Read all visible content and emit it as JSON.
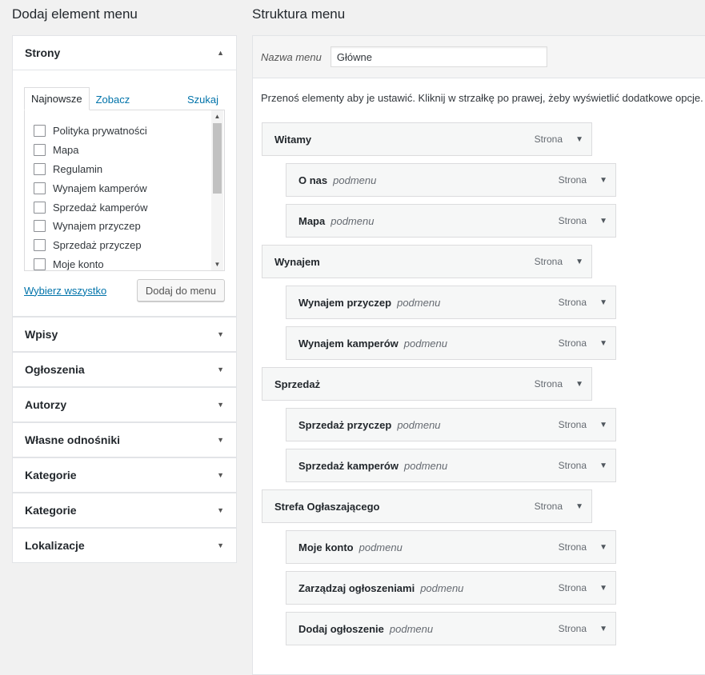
{
  "left": {
    "title": "Dodaj element menu",
    "strony": {
      "heading": "Strony",
      "tabs": [
        "Najnowsze",
        "Zobacz wszystkie",
        "Szukaj"
      ],
      "pages": [
        "Polityka prywatności",
        "Mapa",
        "Regulamin",
        "Wynajem kamperów",
        "Sprzedaż kamperów",
        "Wynajem przyczep",
        "Sprzedaż przyczep",
        "Moje konto"
      ],
      "select_all": "Wybierz wszystko",
      "add_button": "Dodaj do menu"
    },
    "sections": [
      "Wpisy",
      "Ogłoszenia",
      "Autorzy",
      "Własne odnośniki",
      "Kategorie",
      "Kategorie",
      "Lokalizacje"
    ]
  },
  "right": {
    "title": "Struktura menu",
    "menu_name_label": "Nazwa menu",
    "menu_name_value": "Główne",
    "instructions": "Przenoś elementy aby je ustawić. Kliknij w strzałkę po prawej, żeby wyświetlić dodatkowe opcje.",
    "items": [
      {
        "title": "Witamy",
        "sub": "",
        "type": "Strona",
        "depth": 0
      },
      {
        "title": "O nas",
        "sub": "podmenu",
        "type": "Strona",
        "depth": 1
      },
      {
        "title": "Mapa",
        "sub": "podmenu",
        "type": "Strona",
        "depth": 1
      },
      {
        "title": "Wynajem",
        "sub": "",
        "type": "Strona",
        "depth": 0
      },
      {
        "title": "Wynajem przyczep",
        "sub": "podmenu",
        "type": "Strona",
        "depth": 1
      },
      {
        "title": "Wynajem kamperów",
        "sub": "podmenu",
        "type": "Strona",
        "depth": 1
      },
      {
        "title": "Sprzedaż",
        "sub": "",
        "type": "Strona",
        "depth": 0
      },
      {
        "title": "Sprzedaż przyczep",
        "sub": "podmenu",
        "type": "Strona",
        "depth": 1
      },
      {
        "title": "Sprzedaż kamperów",
        "sub": "podmenu",
        "type": "Strona",
        "depth": 1
      },
      {
        "title": "Strefa Ogłaszającego",
        "sub": "",
        "type": "Strona",
        "depth": 0
      },
      {
        "title": "Moje konto",
        "sub": "podmenu",
        "type": "Strona",
        "depth": 1
      },
      {
        "title": "Zarządzaj ogłoszeniami",
        "sub": "podmenu",
        "type": "Strona",
        "depth": 1
      },
      {
        "title": "Dodaj ogłoszenie",
        "sub": "podmenu",
        "type": "Strona",
        "depth": 1
      }
    ]
  },
  "icons": {
    "collapse": "arrow-up-icon",
    "expand": "arrow-down-icon"
  }
}
